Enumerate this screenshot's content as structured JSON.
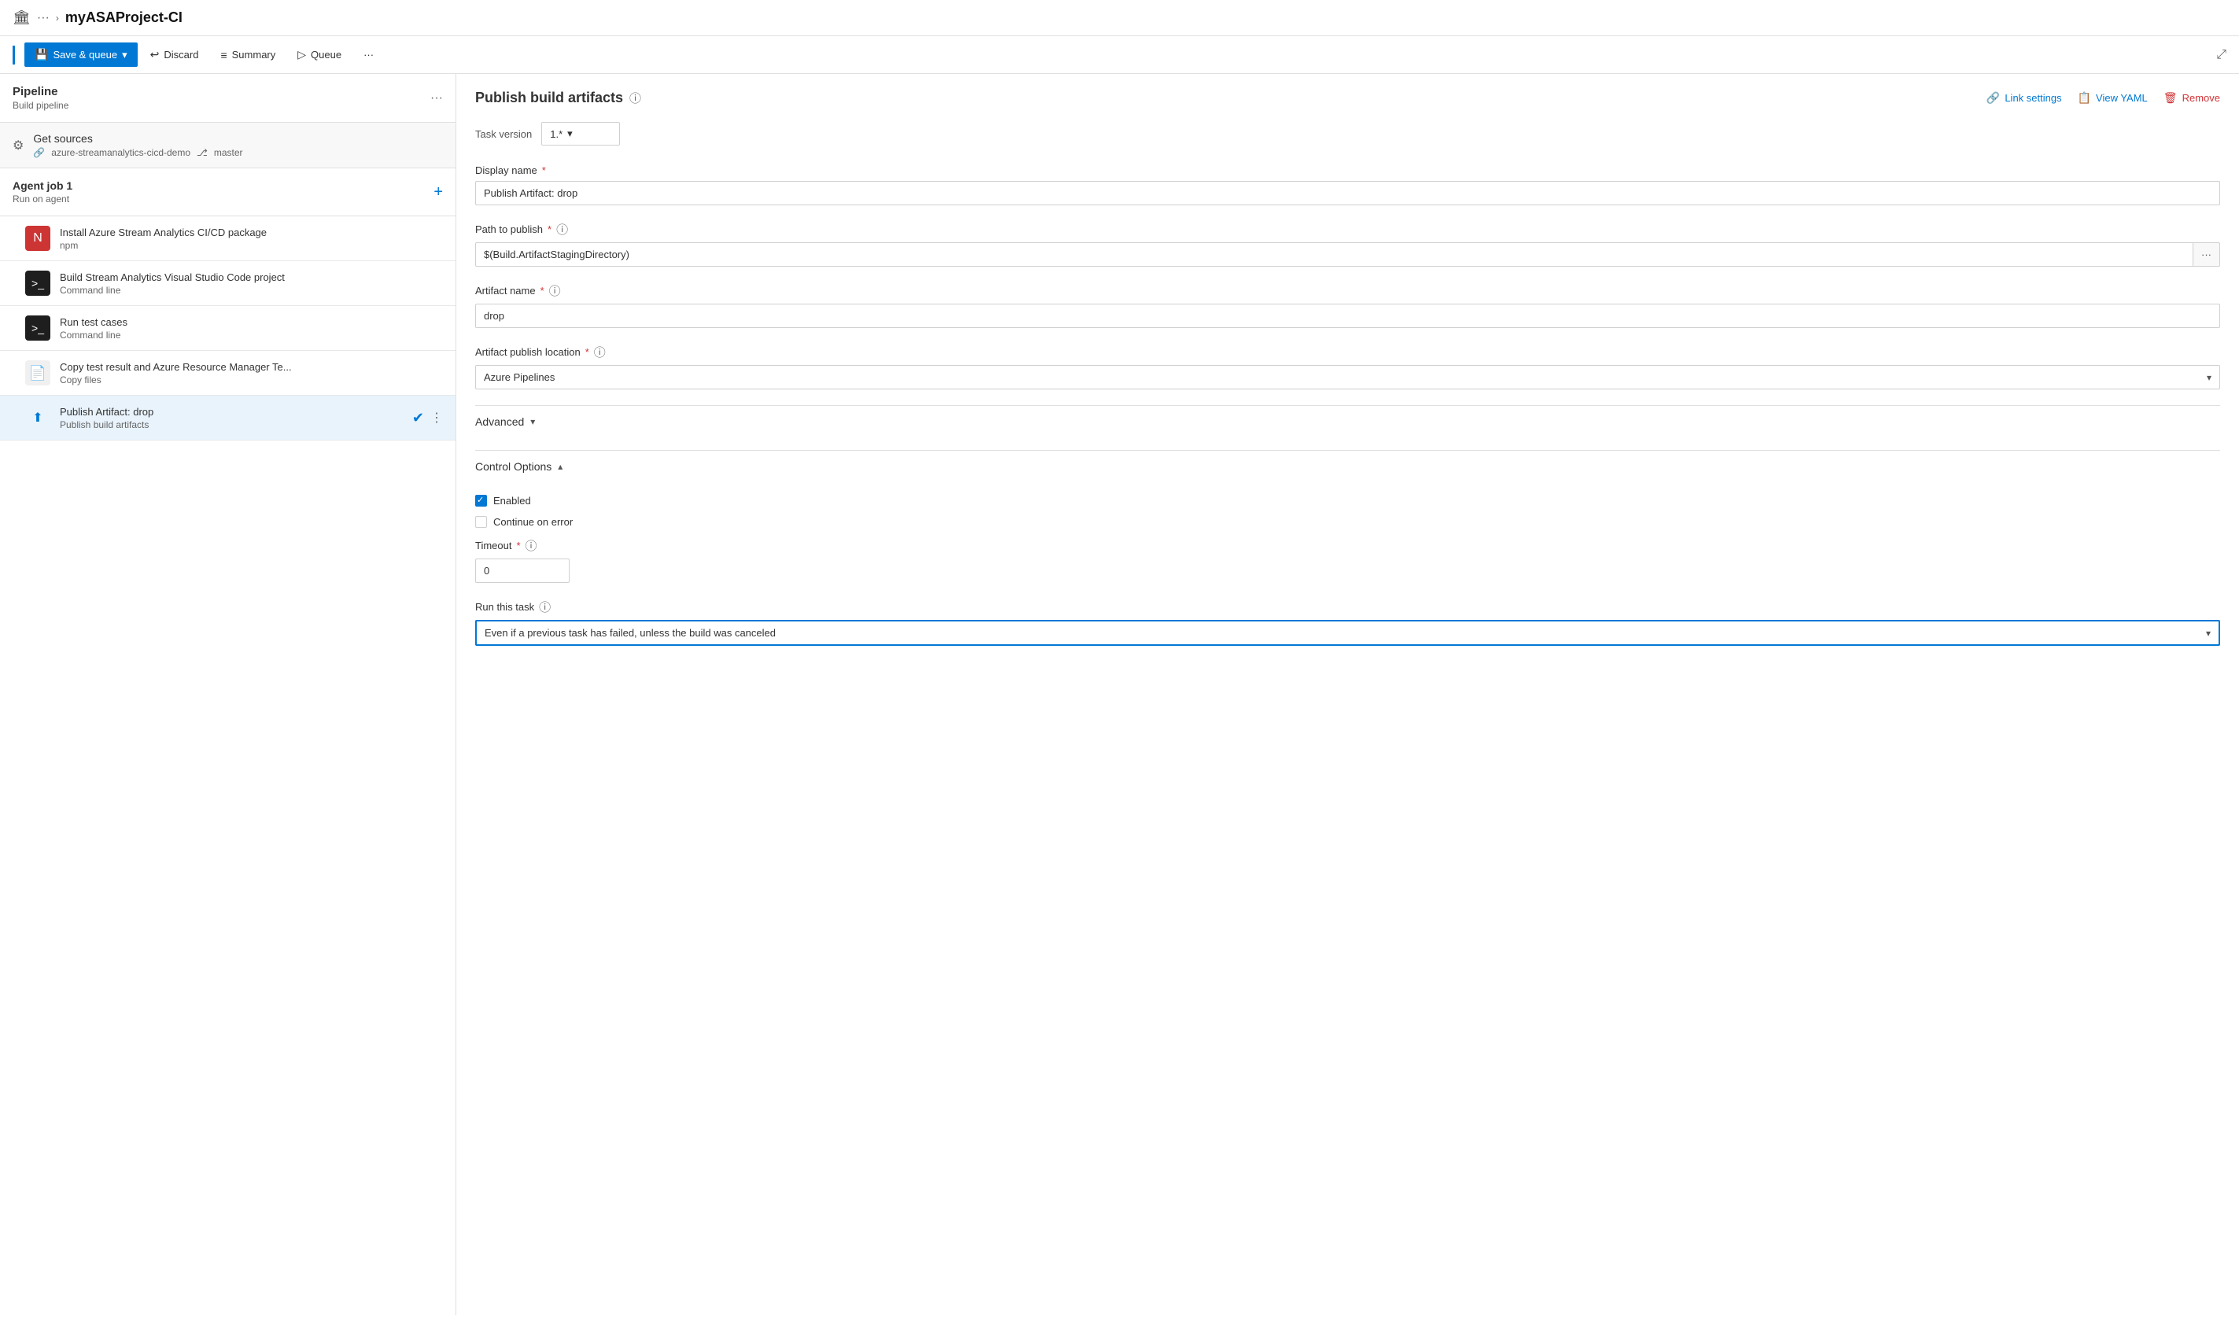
{
  "topbar": {
    "icon": "🏛",
    "dots": "···",
    "chevron": "›",
    "title": "myASAProject-CI"
  },
  "toolbar": {
    "save_queue_label": "Save & queue",
    "discard_label": "Discard",
    "summary_label": "Summary",
    "queue_label": "Queue",
    "more_dots": "···"
  },
  "left_panel": {
    "pipeline_title": "Pipeline",
    "pipeline_subtitle": "Build pipeline",
    "get_sources": {
      "label": "Get sources",
      "repo": "azure-streamanalytics-cicd-demo",
      "branch": "master"
    },
    "agent_job": {
      "title": "Agent job 1",
      "subtitle": "Run on agent"
    },
    "tasks": [
      {
        "id": "npm",
        "icon_type": "npm",
        "icon_text": "N",
        "name": "Install Azure Stream Analytics CI/CD package",
        "subtitle": "npm",
        "active": false
      },
      {
        "id": "cmd1",
        "icon_type": "cmd",
        "icon_text": ">_",
        "name": "Build Stream Analytics Visual Studio Code project",
        "subtitle": "Command line",
        "active": false
      },
      {
        "id": "cmd2",
        "icon_type": "cmd",
        "icon_text": ">_",
        "name": "Run test cases",
        "subtitle": "Command line",
        "active": false
      },
      {
        "id": "copy",
        "icon_type": "copy",
        "icon_text": "📄",
        "name": "Copy test result and Azure Resource Manager Te...",
        "subtitle": "Copy files",
        "active": false
      },
      {
        "id": "publish",
        "icon_type": "publish",
        "icon_text": "⬆",
        "name": "Publish Artifact: drop",
        "subtitle": "Publish build artifacts",
        "active": true
      }
    ]
  },
  "right_panel": {
    "title": "Publish build artifacts",
    "link_settings_label": "Link settings",
    "view_yaml_label": "View YAML",
    "remove_label": "Remove",
    "task_version_label": "Task version",
    "task_version_value": "1.*",
    "display_name_label": "Display name",
    "display_name_required": true,
    "display_name_value": "Publish Artifact: drop",
    "path_to_publish_label": "Path to publish",
    "path_to_publish_required": true,
    "path_to_publish_value": "$(Build.ArtifactStagingDirectory)",
    "artifact_name_label": "Artifact name",
    "artifact_name_required": true,
    "artifact_name_value": "drop",
    "artifact_publish_location_label": "Artifact publish location",
    "artifact_publish_location_required": true,
    "artifact_publish_location_value": "Azure Pipelines",
    "advanced_label": "Advanced",
    "control_options_label": "Control Options",
    "enabled_label": "Enabled",
    "continue_on_error_label": "Continue on error",
    "timeout_label": "Timeout",
    "timeout_required": true,
    "timeout_value": "0",
    "run_this_task_label": "Run this task",
    "run_this_task_value": "Even if a previous task has failed, unless the build was canceled"
  }
}
